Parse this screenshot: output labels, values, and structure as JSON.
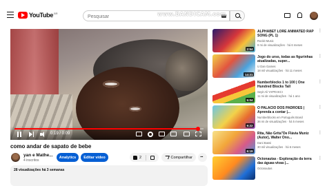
{
  "header": {
    "logo_text": "YouTube",
    "logo_region": "BR",
    "search_placeholder": "Pesquisar",
    "watermark": "www.BANDICAM.com"
  },
  "player": {
    "time": "0:19 / 0:09",
    "progress_fraction": 0.97
  },
  "video": {
    "title": "como andar de sapato de bebe",
    "channel_name": "yan e Mathe...",
    "subscribers": "4 inscritos",
    "analytics_label": "Analytics",
    "edit_label": "Editar vídeo",
    "likes": "2",
    "share_label": "Compartilhar",
    "more_label": "···",
    "stats": "28 visualizações  há 3 semanas"
  },
  "recommendations": [
    {
      "title": "ALPHABET LORE ANIMATED RAP SONG (PL 1)",
      "channel": "Rockit Music",
      "meta": "9 mi de visualizações · há 6 meses",
      "duration": "2:54"
    },
    {
      "title": "Jogo do urso, todas as figurinhas atualizadas, super...",
      "channel": "U Dan Games",
      "meta": "18 mil visualizações · há 11 meses",
      "duration": "14:21"
    },
    {
      "title": "Numberblocks 1 to 100 | One Hundred Blocks Tall",
      "channel": "Seyit Ali YAPRAKCI",
      "meta": "11 mi de visualizações · há 1 ano",
      "duration": "5:04"
    },
    {
      "title": "O PALÁCIO DOS PADRÕES | Aprenda a contar |...",
      "channel": "Numberblocks em Português Brasil",
      "meta": "36 mi de visualizações · há 5 meses",
      "duration": "9:22"
    },
    {
      "title": "Rita, Não Grita\"De Flávia Muniz (Autor), Walter Ono...",
      "channel": "Dani Bassi",
      "meta": "30 mil visualizações · há 6 meses",
      "duration": "6:19"
    },
    {
      "title": "Octonautas - Exploração da terra das águas-vivas |...",
      "channel": "Octonautas",
      "meta": "",
      "duration": ""
    }
  ]
}
